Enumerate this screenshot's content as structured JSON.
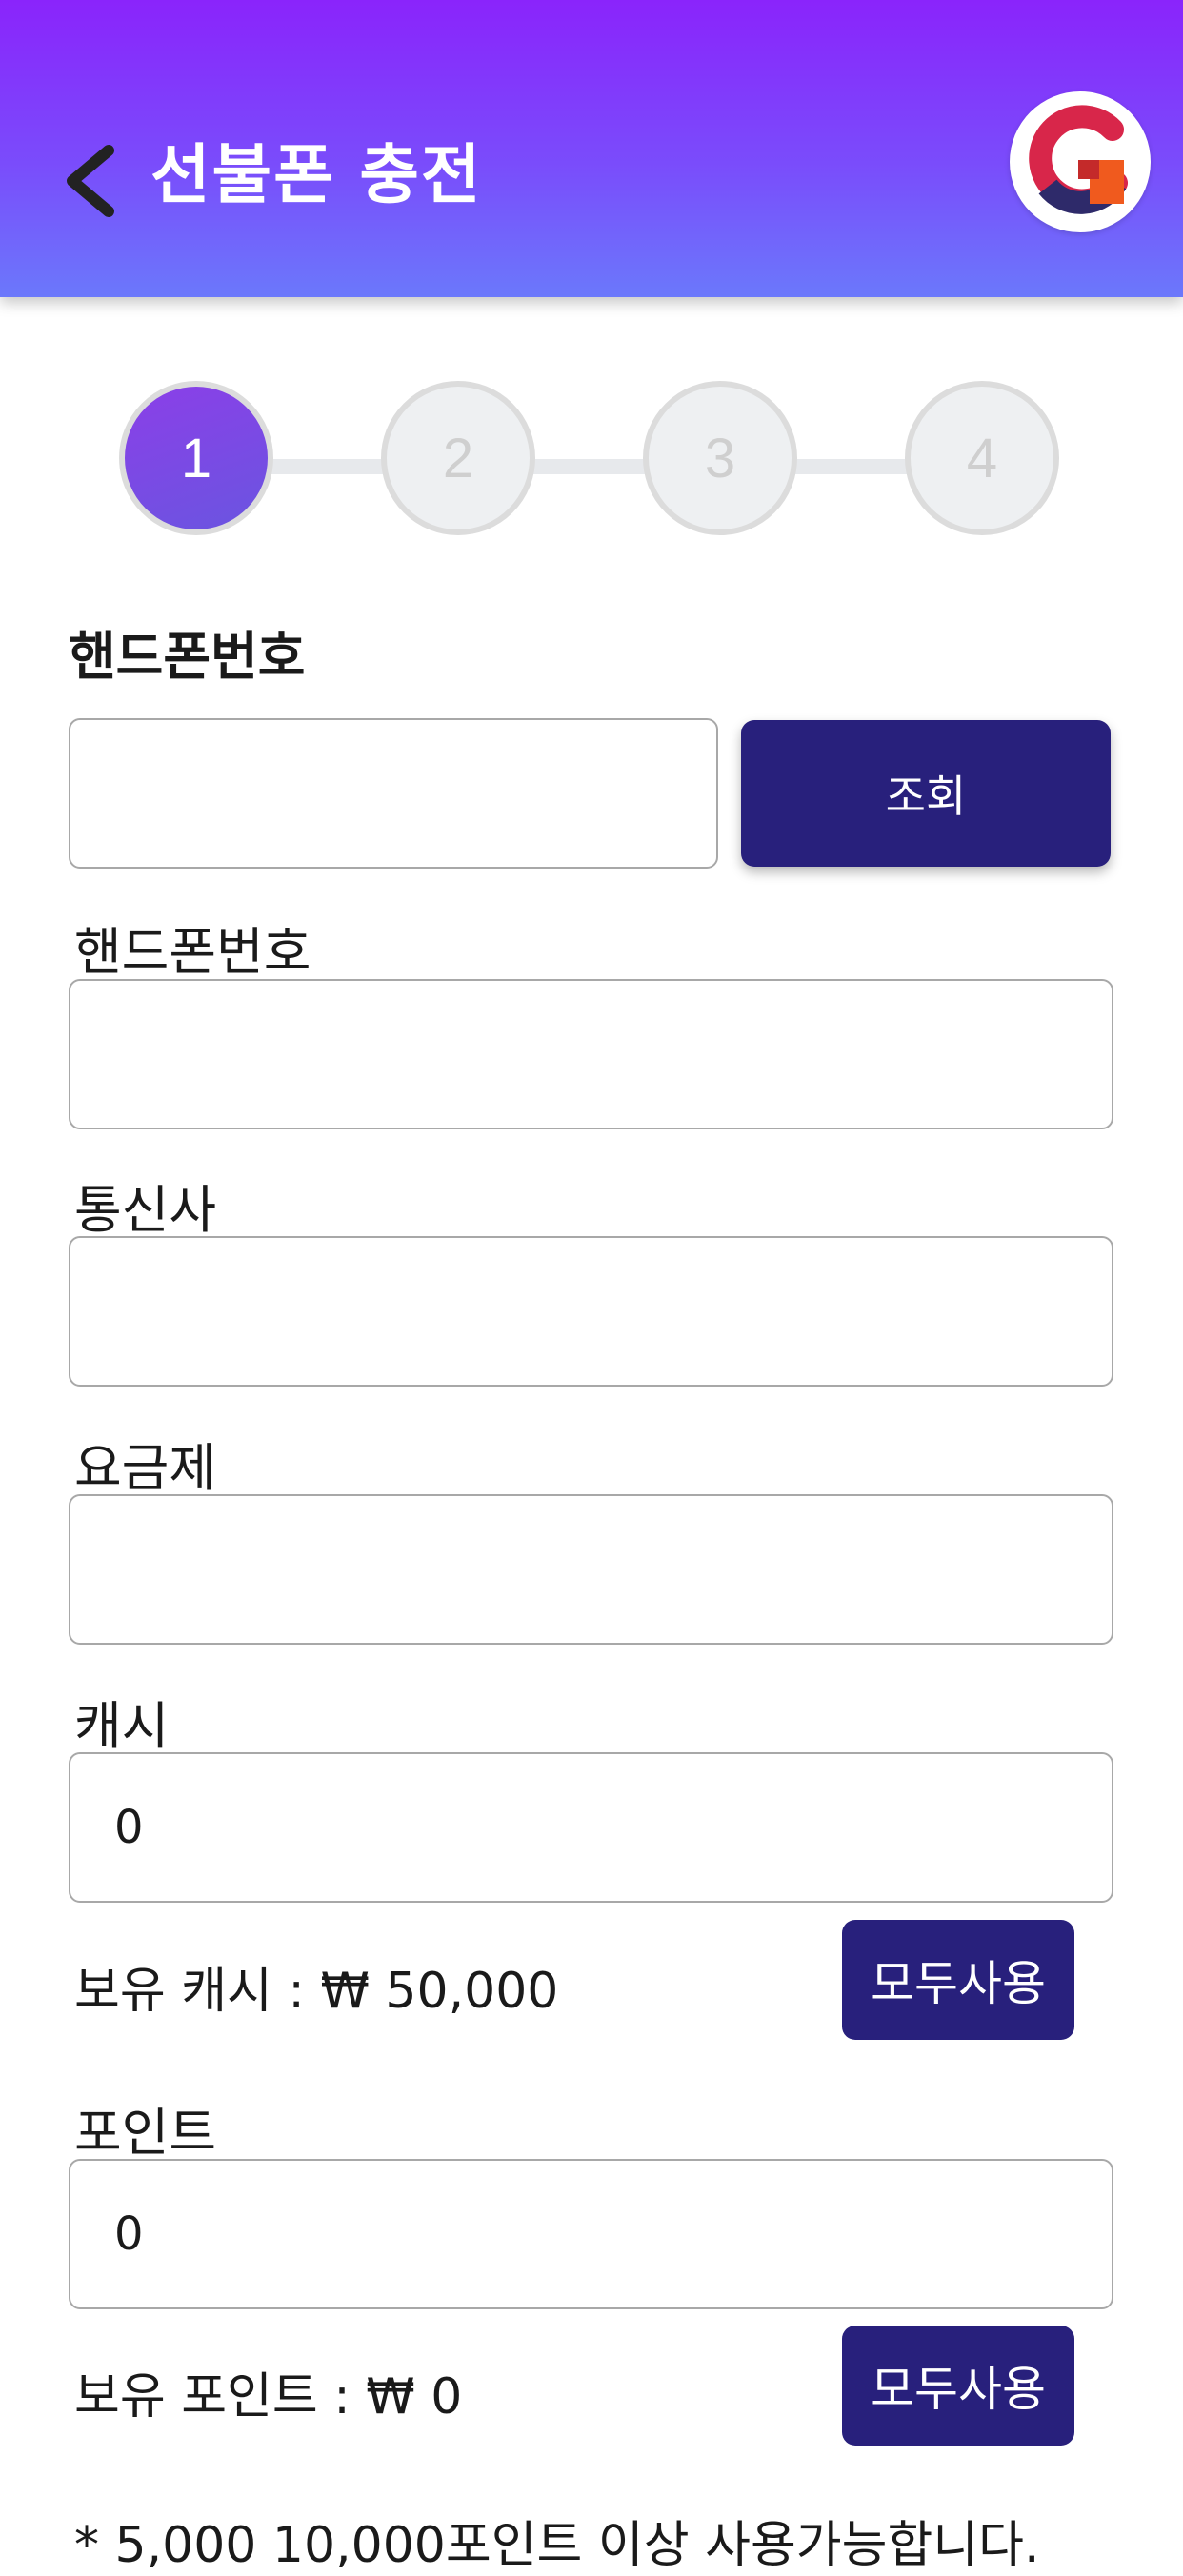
{
  "header": {
    "title": "선불폰 충전",
    "back_icon": "chevron-left-icon",
    "logo_icon": "brand-logo-icon",
    "gradient_top": "#8a24fb",
    "gradient_bottom": "#6b78fb"
  },
  "stepper": {
    "current_step": 1,
    "steps": [
      "1",
      "2",
      "3",
      "4"
    ]
  },
  "lookup": {
    "label": "핸드폰번호",
    "input_value": "",
    "button_label": "조회"
  },
  "form": {
    "phone": {
      "label": "핸드폰번호",
      "value": ""
    },
    "carrier": {
      "label": "통신사",
      "value": ""
    },
    "plan": {
      "label": "요금제",
      "value": ""
    },
    "cash": {
      "label": "캐시",
      "value": "0",
      "balance_text": "보유 캐시 : ₩ 50,000",
      "use_all_label": "모두사용"
    },
    "points": {
      "label": "포인트",
      "value": "0",
      "balance_text": "보유 포인트 : ₩ 0",
      "use_all_label": "모두사용"
    }
  },
  "notice": "* 5,000 10,000포인트 이상 사용가능합니다.",
  "colors": {
    "accent_button": "#28207c",
    "step_active": "#7a4ce6"
  }
}
